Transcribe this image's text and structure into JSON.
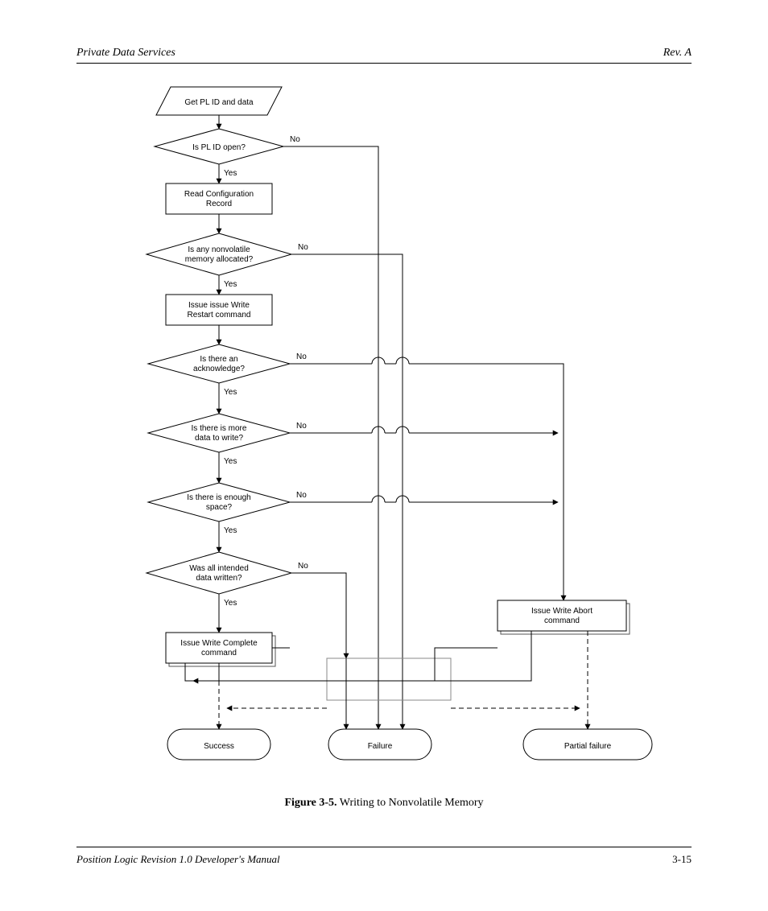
{
  "header": {
    "left": "Private Data Services",
    "right": "Rev. A"
  },
  "footer": {
    "left": "Position Logic Revision 1.0 Developer's Manual",
    "right": "3-15"
  },
  "caption_bold": "Figure 3-5.",
  "caption_rest": " Writing to Nonvolatile Memory",
  "nodes": {
    "input": "Get PL ID and data",
    "d_open": "Is PL ID open?",
    "p_read": "Read Configuration Record",
    "d_avail": "Is any nonvolatile memory allocated?",
    "p_issue": "Issue issue Write Restart command",
    "d_ack": "Is there an acknowledge?",
    "d_more": "Is there is more data to write?",
    "d_space": "Is there is enough space?",
    "d_done": "Was all intended data written?",
    "p_issue2": "Issue Write Complete command",
    "p_issue3": "Issue Write Abort command",
    "t_success": "Success",
    "t_fail": "Failure",
    "t_partial": "Partial failure"
  },
  "edges": {
    "yes": "Yes",
    "no": "No"
  }
}
